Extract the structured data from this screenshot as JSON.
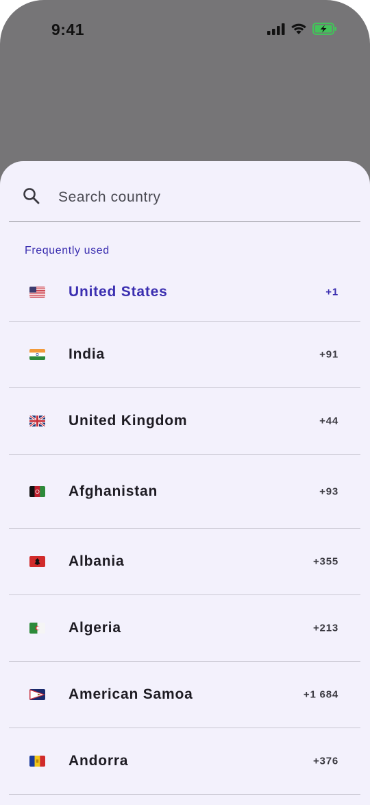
{
  "status_bar": {
    "time": "9:41"
  },
  "search": {
    "placeholder": "Search country"
  },
  "section": {
    "frequently_used": "Frequently used"
  },
  "countries": [
    {
      "name": "United States",
      "code": "+1",
      "flag": "us-flag-icon",
      "selected": true
    },
    {
      "name": "India",
      "code": "+91",
      "flag": "in-flag-icon"
    },
    {
      "name": "United Kingdom",
      "code": "+44",
      "flag": "gb-flag-icon"
    },
    {
      "name": "Afghanistan",
      "code": "+93",
      "flag": "af-flag-icon"
    },
    {
      "name": "Albania",
      "code": "+355",
      "flag": "al-flag-icon"
    },
    {
      "name": "Algeria",
      "code": "+213",
      "flag": "dz-flag-icon"
    },
    {
      "name": "American Samoa",
      "code": "+1 684",
      "flag": "as-flag-icon"
    },
    {
      "name": "Andorra",
      "code": "+376",
      "flag": "ad-flag-icon"
    }
  ],
  "colors": {
    "accent": "#3b2fb0",
    "sheet_background": "#f3f1fc",
    "backdrop": "#767577",
    "battery": "#43c35a"
  }
}
